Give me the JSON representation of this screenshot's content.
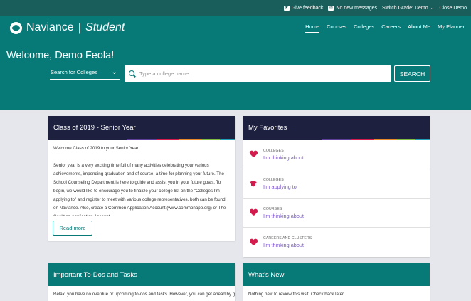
{
  "utility_bar": {
    "feedback": "Give feedback",
    "messages": "No new messages",
    "switch_grade": "Switch Grade: Demo",
    "close_demo": "Close Demo"
  },
  "header": {
    "brand_name": "Naviance",
    "brand_sub": "Student",
    "nav": [
      "Home",
      "Courses",
      "Colleges",
      "Careers",
      "About Me",
      "My Planner"
    ],
    "active_nav": "Home",
    "welcome": "Welcome, Demo Feola!"
  },
  "search": {
    "type_label": "Search for Colleges",
    "placeholder": "Type a college name",
    "button": "SEARCH"
  },
  "senior_card": {
    "title": "Class of 2019 - Senior Year",
    "intro": "Welcome Class of 2019 to your Senior Year!",
    "body": "Senior year is a very exciting time full of many activities celebrating your various achievements, impending graduation and of course, a time for planning your future. The School Counseling Department is here to guide and assist you in your future goals. To begin, we would like to encourage you to finalize your college list on the \"Colleges I'm applying to\" and register to meet with various college representatives, both can be found on Naviance. Also, create a Common Application Account (www.commonapp.org) or The Coalition Application Account.",
    "read_more": "Read more"
  },
  "favorites_card": {
    "title": "My Favorites",
    "items": [
      {
        "category": "COLLEGES",
        "label": "I'm thinking about",
        "icon": "heart-icon"
      },
      {
        "category": "COLLEGES",
        "label": "I'm applying to",
        "icon": "graduation-cap-icon"
      },
      {
        "category": "COURSES",
        "label": "I'm thinking about",
        "icon": "heart-icon"
      },
      {
        "category": "CAREERS AND CLUSTERS",
        "label": "I'm thinking about",
        "icon": "heart-icon"
      }
    ]
  },
  "todos_card": {
    "title": "Important To-Dos and Tasks",
    "text": "Relax, you have no overdue or upcoming to-dos and tasks. However, you can get ahead by going to"
  },
  "whatsnew_card": {
    "title": "What's New",
    "text": "Nothing new to review this visit. Check back later."
  },
  "colors": {
    "teal": "#077a78",
    "dark_teal": "#1a5e5b",
    "navy": "#1e2040",
    "accent_red": "#d41b4e",
    "link_purple": "#7b57c7",
    "stripe": [
      "#5b3f99",
      "#d41b4e",
      "#e88a2a",
      "#7dbb42",
      "#1fa0b8"
    ]
  }
}
